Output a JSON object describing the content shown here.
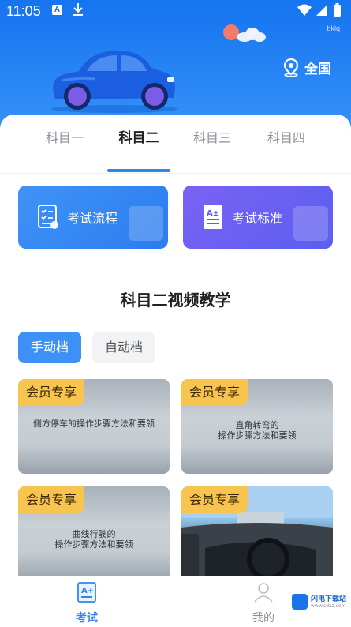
{
  "status_bar": {
    "time": "11:05",
    "notif_a": "A",
    "hint": "bklq"
  },
  "header": {
    "region": "全国"
  },
  "tabs": [
    {
      "label": "科目一"
    },
    {
      "label": "科目二"
    },
    {
      "label": "科目三"
    },
    {
      "label": "科目四"
    }
  ],
  "active_tab_index": 1,
  "cards": [
    {
      "label": "考试流程",
      "icon": "checklist-icon",
      "color": "#3d8ef3"
    },
    {
      "label": "考试标准",
      "icon": "document-icon",
      "color": "#6b5ff2"
    }
  ],
  "section_title": "科目二视频教学",
  "transmission": {
    "manual": "手动档",
    "auto": "自动档"
  },
  "videos": [
    {
      "badge": "会员专享",
      "caption": [
        "侧方停车的操作步骤方法和要领"
      ]
    },
    {
      "badge": "会员专享",
      "caption": [
        "直角转弯的",
        "操作步骤方法和要领"
      ]
    },
    {
      "badge": "会员专享",
      "caption": [
        "曲线行驶的",
        "操作步骤方法和要领"
      ]
    },
    {
      "badge": "会员专享",
      "caption": []
    }
  ],
  "bottom_nav": [
    {
      "label": "考试",
      "icon": "exam-icon"
    },
    {
      "label": "我的",
      "icon": "user-icon"
    }
  ],
  "watermark": {
    "text": "闪电下载站",
    "sub": "www.sdxz.com"
  },
  "colors": {
    "primary": "#2c86f0",
    "badge": "#f7c44f"
  }
}
